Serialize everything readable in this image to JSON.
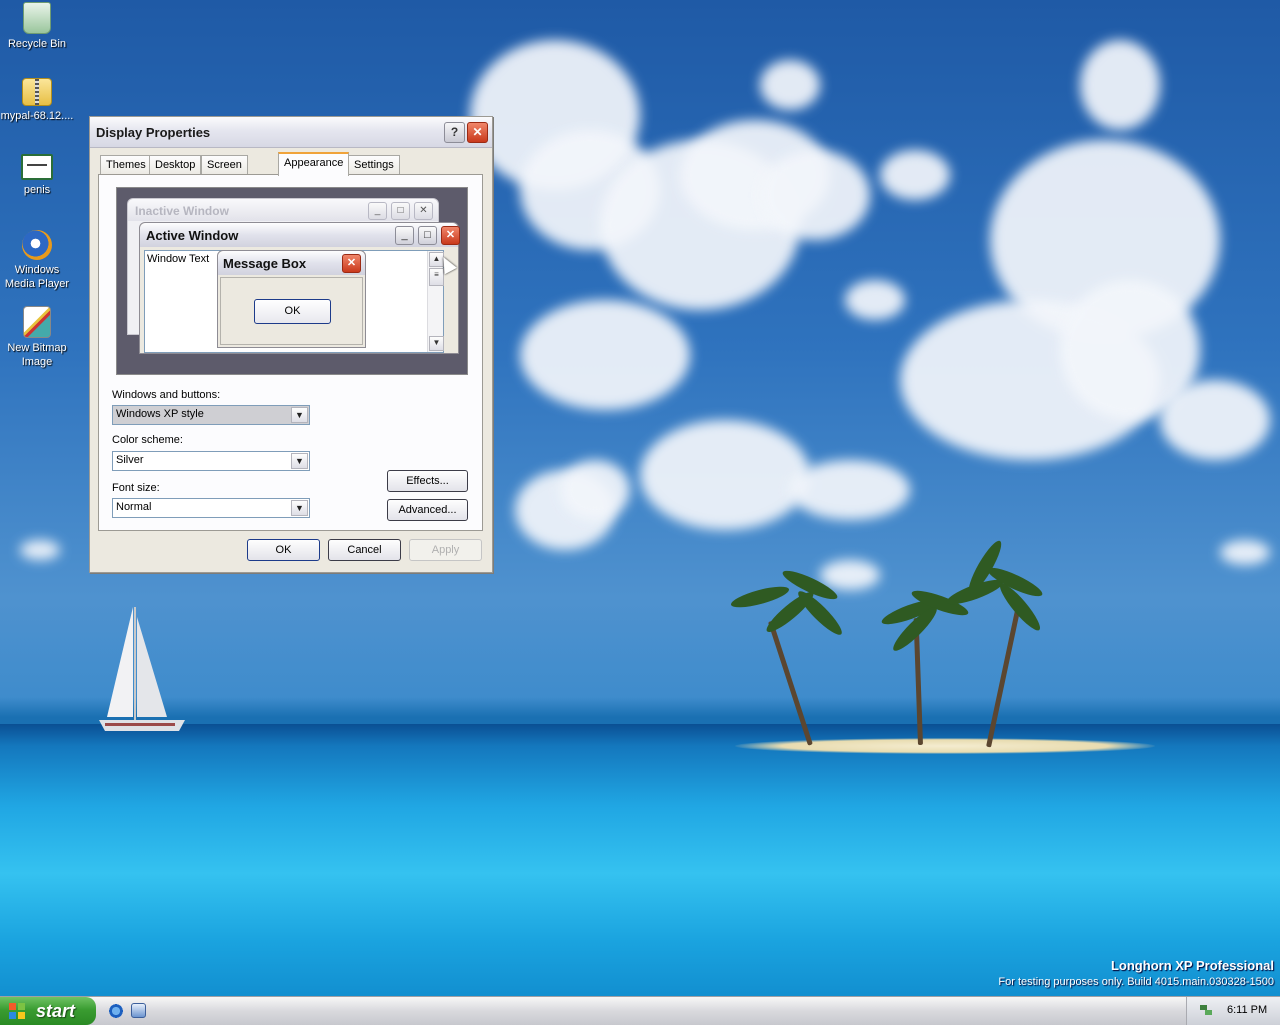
{
  "desktop": {
    "icons": [
      {
        "label": "Recycle Bin",
        "icon": "recycle-bin-icon"
      },
      {
        "label": "mypal-68.12....",
        "icon": "zip-folder-icon"
      },
      {
        "label": "penis",
        "icon": "bitmap-image-icon"
      },
      {
        "label_line1": "Windows",
        "label_line2": "Media Player",
        "icon": "media-player-icon"
      },
      {
        "label_line1": "New Bitmap",
        "label_line2": "Image",
        "icon": "paint-image-icon"
      }
    ],
    "watermark_title": "Longhorn XP Professional",
    "watermark_sub": "For testing purposes only. Build 4015.main.030328-1500"
  },
  "dialog": {
    "title": "Display Properties",
    "help_glyph": "?",
    "close_glyph": "✕",
    "tabs": [
      "Themes",
      "Desktop",
      "Screen Saver",
      "Appearance",
      "Settings"
    ],
    "active_tab": "Appearance",
    "preview": {
      "inactive_title": "Inactive Window",
      "active_title": "Active Window",
      "window_text": "Window Text",
      "message_title": "Message Box",
      "message_ok": "OK"
    },
    "windows_buttons_label": "Windows and buttons:",
    "windows_buttons_value": "Windows XP style",
    "color_scheme_label": "Color scheme:",
    "color_scheme_value": "Silver",
    "font_size_label": "Font size:",
    "font_size_value": "Normal",
    "effects_button": "Effects...",
    "advanced_button": "Advanced...",
    "ok_button": "OK",
    "cancel_button": "Cancel",
    "apply_button": "Apply"
  },
  "taskbar": {
    "start_label": "start",
    "clock": "6:11 PM"
  },
  "colors": {
    "start_green": "#3a9c31",
    "close_red": "#c9391c",
    "tab_accent": "#f0a33a"
  }
}
